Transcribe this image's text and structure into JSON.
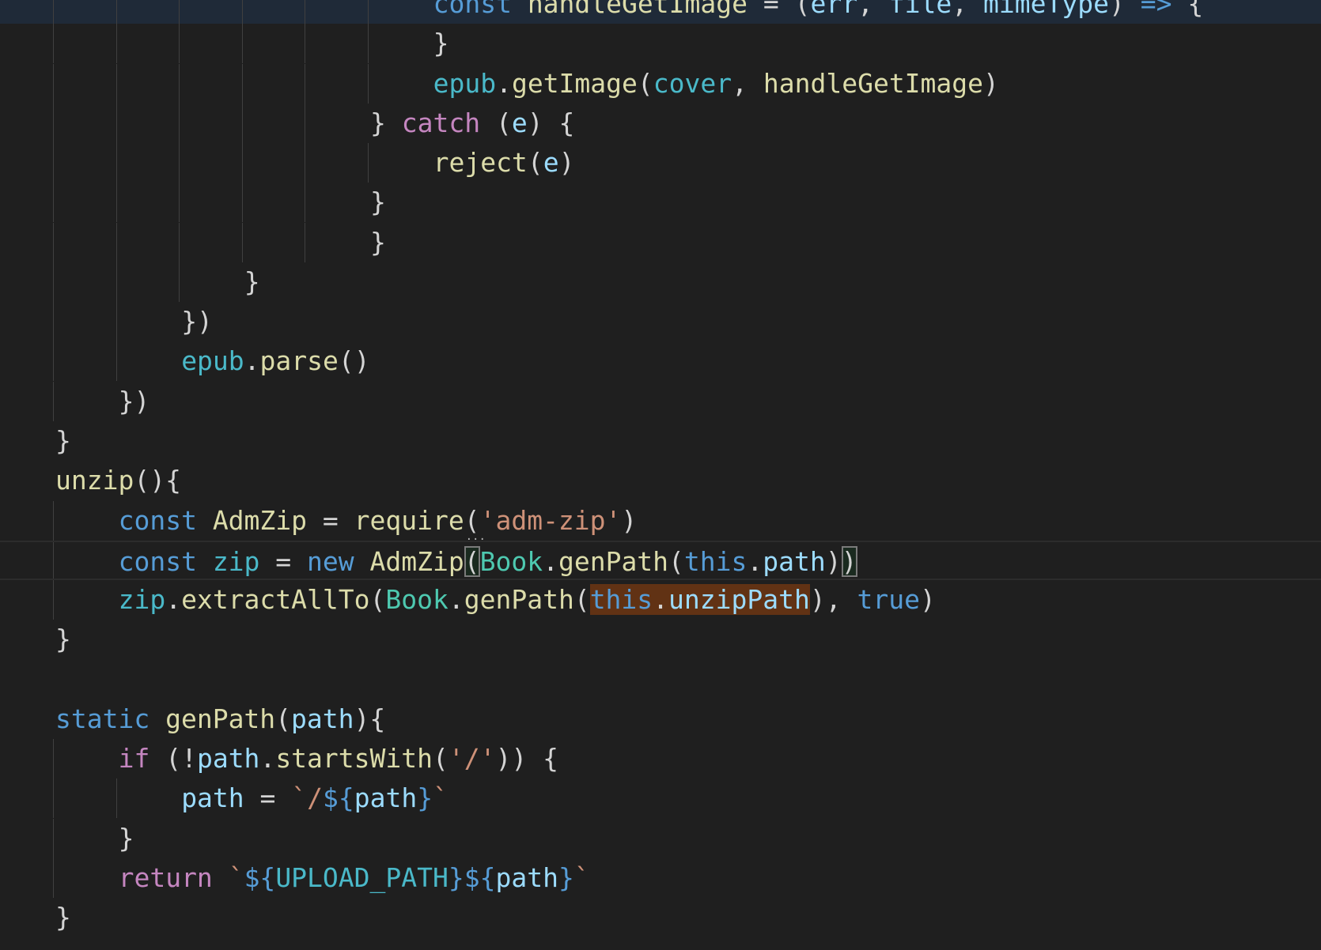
{
  "editor": {
    "language": "javascript",
    "colors": {
      "background": "#1f1f1f",
      "kw": "#569cd6",
      "ctrl": "#c586c0",
      "fn": "#dcdcaa",
      "var": "#9cdcfe",
      "const": "#4ab9c9",
      "cls": "#4ec9b0",
      "str": "#ce9178",
      "tpl": "#569cd6",
      "p": "#d4d4d4",
      "selection_highlight": "#613214"
    },
    "fold_icon": "ellipsis-icon",
    "lines": [
      {
        "indent": 6,
        "tokens": [
          [
            "const",
            "kw"
          ],
          [
            " ",
            "p"
          ],
          [
            "handleGetImage",
            "fn"
          ],
          [
            " = ",
            "p"
          ],
          [
            "(",
            "p"
          ],
          [
            "err",
            "var"
          ],
          [
            ", ",
            "p"
          ],
          [
            "file",
            "var"
          ],
          [
            ", ",
            "p"
          ],
          [
            "mimeType",
            "var"
          ],
          [
            ") ",
            "p"
          ],
          [
            "=>",
            "kw"
          ],
          [
            " {",
            "p"
          ]
        ],
        "folded": true
      },
      {
        "indent": 6,
        "tokens": [
          [
            "}",
            "p"
          ]
        ]
      },
      {
        "indent": 6,
        "tokens": [
          [
            "epub",
            "const"
          ],
          [
            ".",
            "p"
          ],
          [
            "getImage",
            "fn"
          ],
          [
            "(",
            "p"
          ],
          [
            "cover",
            "const"
          ],
          [
            ", ",
            "p"
          ],
          [
            "handleGetImage",
            "fn"
          ],
          [
            ")",
            "p"
          ]
        ]
      },
      {
        "indent": 5,
        "tokens": [
          [
            "} ",
            "p"
          ],
          [
            "catch",
            "ctrl"
          ],
          [
            " (",
            "p"
          ],
          [
            "e",
            "var"
          ],
          [
            ") {",
            "p"
          ]
        ]
      },
      {
        "indent": 6,
        "tokens": [
          [
            "reject",
            "fn"
          ],
          [
            "(",
            "p"
          ],
          [
            "e",
            "var"
          ],
          [
            ")",
            "p"
          ]
        ]
      },
      {
        "indent": 5,
        "tokens": [
          [
            "}",
            "p"
          ]
        ]
      },
      {
        "indent": 5,
        "tokens": [
          [
            "}",
            "p"
          ]
        ]
      },
      {
        "indent": 3,
        "tokens": [
          [
            "}",
            "p"
          ]
        ]
      },
      {
        "indent": 2,
        "tokens": [
          [
            "})",
            "p"
          ]
        ]
      },
      {
        "indent": 2,
        "tokens": [
          [
            "epub",
            "const"
          ],
          [
            ".",
            "p"
          ],
          [
            "parse",
            "fn"
          ],
          [
            "()",
            "p"
          ]
        ]
      },
      {
        "indent": 1,
        "tokens": [
          [
            "})",
            "p"
          ]
        ]
      },
      {
        "indent": 0,
        "tokens": [
          [
            "}",
            "p"
          ]
        ]
      },
      {
        "indent": 0,
        "tokens": [
          [
            "unzip",
            "fn"
          ],
          [
            "(){",
            "p"
          ]
        ]
      },
      {
        "indent": 1,
        "tokens": [
          [
            "const",
            "kw"
          ],
          [
            " ",
            "p"
          ],
          [
            "AdmZip",
            "fn"
          ],
          [
            " = ",
            "p"
          ],
          [
            "require",
            "fn"
          ],
          [
            "(",
            "p"
          ],
          [
            "'adm-zip'",
            "str"
          ],
          [
            ")",
            "p"
          ]
        ],
        "hint": "..."
      },
      {
        "indent": 1,
        "tokens": [
          [
            "const",
            "kw"
          ],
          [
            " ",
            "p"
          ],
          [
            "zip",
            "const"
          ],
          [
            " = ",
            "p"
          ],
          [
            "new",
            "kw"
          ],
          [
            " ",
            "p"
          ],
          [
            "AdmZip",
            "fn"
          ],
          [
            "(",
            "p",
            "box"
          ],
          [
            "Book",
            "cls"
          ],
          [
            ".",
            "p"
          ],
          [
            "genPath",
            "fn"
          ],
          [
            "(",
            "p"
          ],
          [
            "this",
            "kw"
          ],
          [
            ".",
            "p"
          ],
          [
            "path",
            "var"
          ],
          [
            ")",
            "p"
          ],
          [
            ")",
            "p",
            "box"
          ]
        ],
        "current": true
      },
      {
        "indent": 1,
        "tokens": [
          [
            "zip",
            "const"
          ],
          [
            ".",
            "p"
          ],
          [
            "extractAllTo",
            "fn"
          ],
          [
            "(",
            "p"
          ],
          [
            "Book",
            "cls"
          ],
          [
            ".",
            "p"
          ],
          [
            "genPath",
            "fn"
          ],
          [
            "(",
            "p"
          ],
          [
            "this",
            "kw",
            "hl"
          ],
          [
            ".",
            "p",
            "hl"
          ],
          [
            "unzipPath",
            "var",
            "hl"
          ],
          [
            "), ",
            "p"
          ],
          [
            "true",
            "kw"
          ],
          [
            ")",
            "p"
          ]
        ]
      },
      {
        "indent": 0,
        "tokens": [
          [
            "}",
            "p"
          ]
        ]
      },
      {
        "indent": 0,
        "tokens": []
      },
      {
        "indent": 0,
        "tokens": [
          [
            "static",
            "kw"
          ],
          [
            " ",
            "p"
          ],
          [
            "genPath",
            "fn"
          ],
          [
            "(",
            "p"
          ],
          [
            "path",
            "var"
          ],
          [
            "){",
            "p"
          ]
        ]
      },
      {
        "indent": 1,
        "tokens": [
          [
            "if",
            "ctrl"
          ],
          [
            " (!",
            "p"
          ],
          [
            "path",
            "var"
          ],
          [
            ".",
            "p"
          ],
          [
            "startsWith",
            "fn"
          ],
          [
            "(",
            "p"
          ],
          [
            "'/'",
            "str"
          ],
          [
            ")) {",
            "p"
          ]
        ]
      },
      {
        "indent": 2,
        "tokens": [
          [
            "path",
            "var"
          ],
          [
            " = ",
            "p"
          ],
          [
            "`/",
            "str"
          ],
          [
            "${",
            "tpl"
          ],
          [
            "path",
            "var"
          ],
          [
            "}",
            "tpl"
          ],
          [
            "`",
            "str"
          ]
        ]
      },
      {
        "indent": 1,
        "tokens": [
          [
            "}",
            "p"
          ]
        ]
      },
      {
        "indent": 1,
        "tokens": [
          [
            "return",
            "ctrl"
          ],
          [
            " ",
            "p"
          ],
          [
            "`",
            "str"
          ],
          [
            "${",
            "tpl"
          ],
          [
            "UPLOAD_PATH",
            "const"
          ],
          [
            "}",
            "tpl"
          ],
          [
            "${",
            "tpl"
          ],
          [
            "path",
            "var"
          ],
          [
            "}",
            "tpl"
          ],
          [
            "`",
            "str"
          ]
        ]
      },
      {
        "indent": 0,
        "tokens": [
          [
            "}",
            "p"
          ]
        ]
      }
    ]
  }
}
